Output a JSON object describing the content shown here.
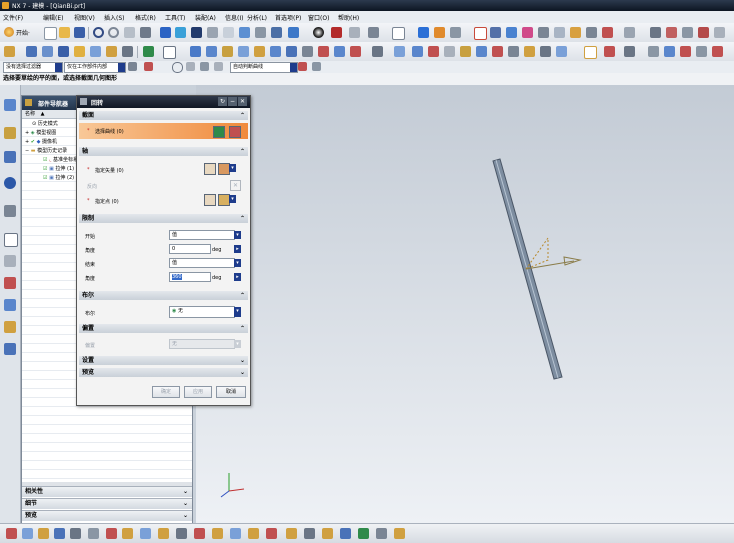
{
  "window": {
    "title": "NX 7 - 建模 - [QianBi.prt]"
  },
  "menu": [
    "文件(F)",
    "编辑(E)",
    "视图(V)",
    "插入(S)",
    "格式(R)",
    "工具(T)",
    "装配(A)",
    "信息(I)",
    "分析(L)",
    "首选项(P)",
    "窗口(O)",
    "帮助(H)"
  ],
  "toolbar": {
    "start_label": "开始·"
  },
  "selection_bar": {
    "filter": "没有选择过滤器",
    "scope": "仅在工作部件内部",
    "curve_rule": "自动判断曲线"
  },
  "cue": "选择要草绘的平的面，或选择截面几何图形",
  "navigator": {
    "title": "部件导航器",
    "column_name": "名称",
    "items": [
      "历史模式",
      "模型视图",
      "摄像机",
      "模型历史记录",
      "基准坐标系 (0)",
      "拉伸 (1)",
      "拉伸 (2)"
    ],
    "footer": [
      "相关性",
      "细节",
      "预览"
    ]
  },
  "dialog": {
    "title": "回转",
    "sections": {
      "section": "截面",
      "axis": "轴",
      "limits": "限制",
      "boolean": "布尔",
      "offset": "偏置",
      "settings": "设置",
      "preview": "预览"
    },
    "select_curve": "选择曲线 (0)",
    "specify_vector": "指定矢量 (0)",
    "reverse": "反向",
    "specify_point": "指定点 (0)",
    "start_label": "开始",
    "start_type": "值",
    "angle_label": "角度",
    "start_angle": "0",
    "end_label": "结束",
    "end_type": "值",
    "end_angle": "360",
    "unit": "deg",
    "boolean_label": "布尔",
    "boolean_value": "无",
    "offset_label": "偏置",
    "offset_value": "无",
    "ok": "确定",
    "apply": "应用",
    "cancel": "取消"
  },
  "colors": {
    "accent": "#1e3c8c",
    "highlight": "#f08a3c",
    "titlebar": "#1c2636"
  }
}
